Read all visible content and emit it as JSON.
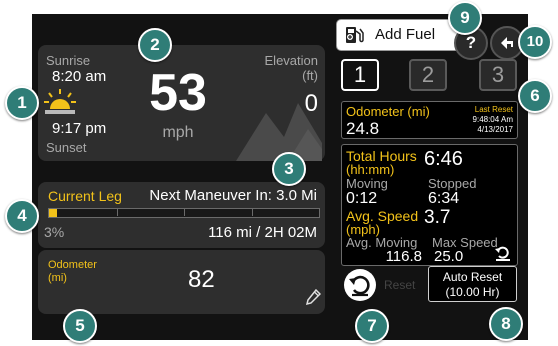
{
  "header": {
    "add_fuel_label": "Add Fuel",
    "help_label": "?"
  },
  "speed_panel": {
    "sunrise_label": "Sunrise",
    "sunrise_time": "8:20 am",
    "sunset_time": "9:17 pm",
    "sunset_label": "Sunset",
    "speed_value": "53",
    "speed_unit": "mph",
    "elevation_label": "Elevation",
    "elevation_unit": "(ft)",
    "elevation_value": "0"
  },
  "leg_panel": {
    "current_leg_label": "Current Leg",
    "next_maneuver_label": "Next Maneuver In: 3.0 Mi",
    "percent_label": "3%",
    "progress_fraction": 0.03,
    "distance_time": "116 mi / 2H 02M"
  },
  "odometer_panel": {
    "label": "Odometer",
    "unit": "(mi)",
    "value": "82"
  },
  "trip_tabs": [
    "1",
    "2",
    "3"
  ],
  "trip_odometer": {
    "label": "Odometer (mi)",
    "value": "24.8",
    "last_reset_label": "Last Reset",
    "reset_time": "9:48:04 Am",
    "reset_date": "4/13/2017"
  },
  "trip_stats": {
    "total_hours_label": "Total Hours",
    "total_hours_unit": "(hh:mm)",
    "total_hours_value": "6:46",
    "moving_label": "Moving",
    "moving_value": "0:12",
    "stopped_label": "Stopped",
    "stopped_value": "6:34",
    "avg_speed_label": "Avg. Speed",
    "avg_speed_unit": "(mph)",
    "avg_speed_value": "3.7",
    "avg_moving_label": "Avg. Moving",
    "avg_moving_value": "116.8",
    "max_speed_label": "Max Speed",
    "max_speed_value": "25.0"
  },
  "reset": {
    "reset_label": "Reset",
    "auto_reset_label": "Auto Reset",
    "auto_reset_value": "(10.00 Hr)"
  },
  "callouts": [
    "1",
    "2",
    "3",
    "4",
    "5",
    "6",
    "7",
    "8",
    "9",
    "10"
  ],
  "colors": {
    "callout": "#2f7d77",
    "accent_yellow": "#f2c21a",
    "panel": "#2e2e2e"
  }
}
